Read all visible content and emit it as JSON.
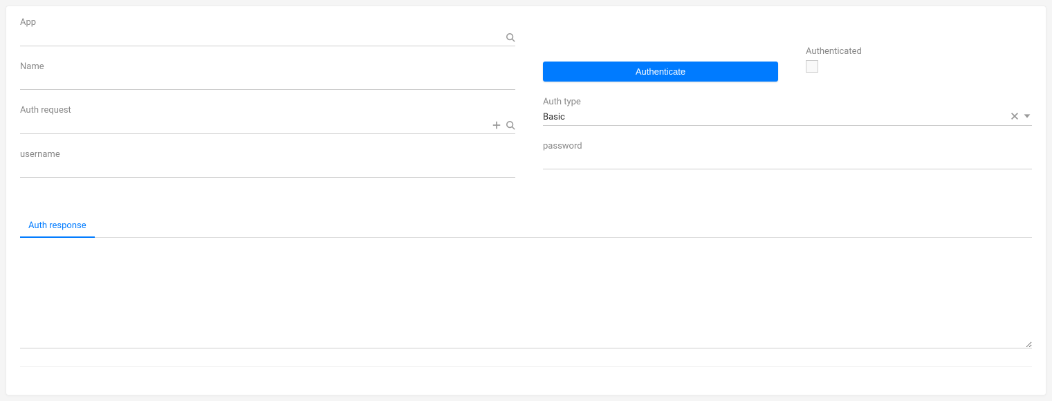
{
  "fields": {
    "app": {
      "label": "App",
      "value": ""
    },
    "name": {
      "label": "Name",
      "value": ""
    },
    "auth_request": {
      "label": "Auth request",
      "value": ""
    },
    "username": {
      "label": "username",
      "value": ""
    },
    "password": {
      "label": "password",
      "value": ""
    },
    "auth_type": {
      "label": "Auth type",
      "value": "Basic"
    },
    "authenticated": {
      "label": "Authenticated",
      "checked": false
    }
  },
  "actions": {
    "authenticate": "Authenticate"
  },
  "tabs": {
    "auth_response": "Auth response"
  },
  "auth_response_value": ""
}
